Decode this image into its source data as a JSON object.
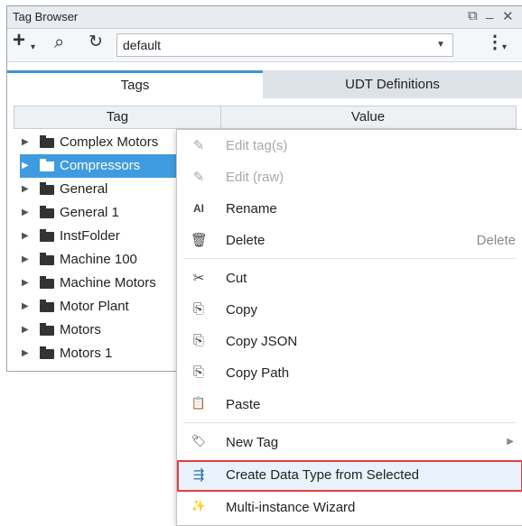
{
  "window": {
    "title": "Tag Browser",
    "restore_glyph": "⧉",
    "minimize_glyph": "_",
    "close_glyph": "✕"
  },
  "toolbar": {
    "add_icon": "+",
    "add_caret": "▾",
    "search_icon": "⌕",
    "refresh_icon": "↻",
    "provider_value": "default",
    "provider_arrow": "▼",
    "more_icon": "⋮",
    "more_caret": "▾"
  },
  "tabs": [
    {
      "label": "Tags"
    },
    {
      "label": "UDT Definitions"
    }
  ],
  "columns": {
    "tag": "Tag",
    "value": "Value"
  },
  "tree": [
    {
      "label": "Complex Motors",
      "selected": false
    },
    {
      "label": "Compressors",
      "selected": true
    },
    {
      "label": "General",
      "selected": false
    },
    {
      "label": "General 1",
      "selected": false
    },
    {
      "label": "InstFolder",
      "selected": false
    },
    {
      "label": "Machine 100",
      "selected": false
    },
    {
      "label": "Machine Motors",
      "selected": false
    },
    {
      "label": "Motor Plant",
      "selected": false
    },
    {
      "label": "Motors",
      "selected": false
    },
    {
      "label": "Motors 1",
      "selected": false
    }
  ],
  "tree_arrow": "▶",
  "menu": {
    "items": [
      {
        "icon": "pencil-icon",
        "glyph": "✎",
        "label": "Edit tag(s)",
        "disabled": true
      },
      {
        "icon": "pencil-icon",
        "glyph": "✎",
        "label": "Edit (raw)",
        "disabled": true
      },
      {
        "icon": "rename-icon",
        "glyph": "AI",
        "label": "Rename"
      },
      {
        "icon": "trash-icon",
        "glyph": "🗑",
        "label": "Delete",
        "shortcut": "Delete"
      },
      {
        "icon": "scissors-icon",
        "glyph": "✂",
        "label": "Cut"
      },
      {
        "icon": "copy-icon",
        "glyph": "⎘",
        "label": "Copy"
      },
      {
        "icon": "copy-json-icon",
        "glyph": "⎘",
        "label": "Copy JSON"
      },
      {
        "icon": "copy-path-icon",
        "glyph": "⎘",
        "label": "Copy Path"
      },
      {
        "icon": "clipboard-icon",
        "glyph": "📋",
        "label": "Paste"
      },
      {
        "icon": "new-tag-icon",
        "glyph": "🏷",
        "label": "New Tag",
        "submenu_arrow": "▶"
      },
      {
        "icon": "create-data-type-icon",
        "glyph": "⇶",
        "label": "Create Data Type from Selected",
        "highlighted": true
      },
      {
        "icon": "wizard-icon",
        "glyph": "✨",
        "label": "Multi-instance Wizard"
      }
    ]
  },
  "colors": {
    "accent": "#3f9be0",
    "highlight_border": "#e4403f"
  }
}
